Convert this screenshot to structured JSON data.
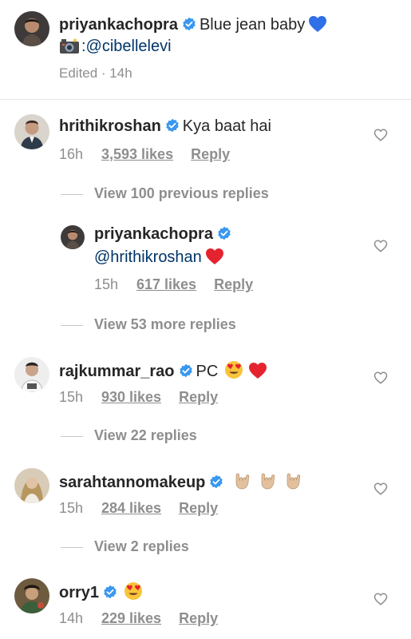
{
  "caption": {
    "username": "priyankachopra",
    "text": "Blue jean baby",
    "emoji": "blue-heart",
    "line2_mention": ":@cibellelevi",
    "meta": "Edited · 14h"
  },
  "comments": [
    {
      "username": "hrithikroshan",
      "text": "Kya baat hai",
      "time": "16h",
      "likes": "3,593 likes",
      "reply": "Reply"
    },
    {
      "view_replies": "View 100 previous replies"
    },
    {
      "username": "priyankachopra",
      "mention": "@hrithikroshan",
      "emoji": "red-heart",
      "time": "15h",
      "likes": "617 likes",
      "reply": "Reply"
    },
    {
      "view_replies": "View 53 more replies"
    },
    {
      "username": "rajkummar_rao",
      "text": "PC",
      "emojis": [
        "heart-eyes",
        "red-heart"
      ],
      "time": "15h",
      "likes": "930 likes",
      "reply": "Reply"
    },
    {
      "view_replies": "View 22 replies"
    },
    {
      "username": "sarahtannomakeup",
      "emojis": [
        "rock-on-hand",
        "rock-on-hand",
        "rock-on-hand"
      ],
      "time": "15h",
      "likes": "284 likes",
      "reply": "Reply"
    },
    {
      "view_replies": "View 2 replies"
    },
    {
      "username": "orry1",
      "emojis": [
        "heart-eyes"
      ],
      "time": "14h",
      "likes": "229 likes",
      "reply": "Reply"
    }
  ],
  "colors": {
    "text": "#262626",
    "muted": "#8e8e8e",
    "mention": "#003569",
    "verified": "#3897f0"
  }
}
